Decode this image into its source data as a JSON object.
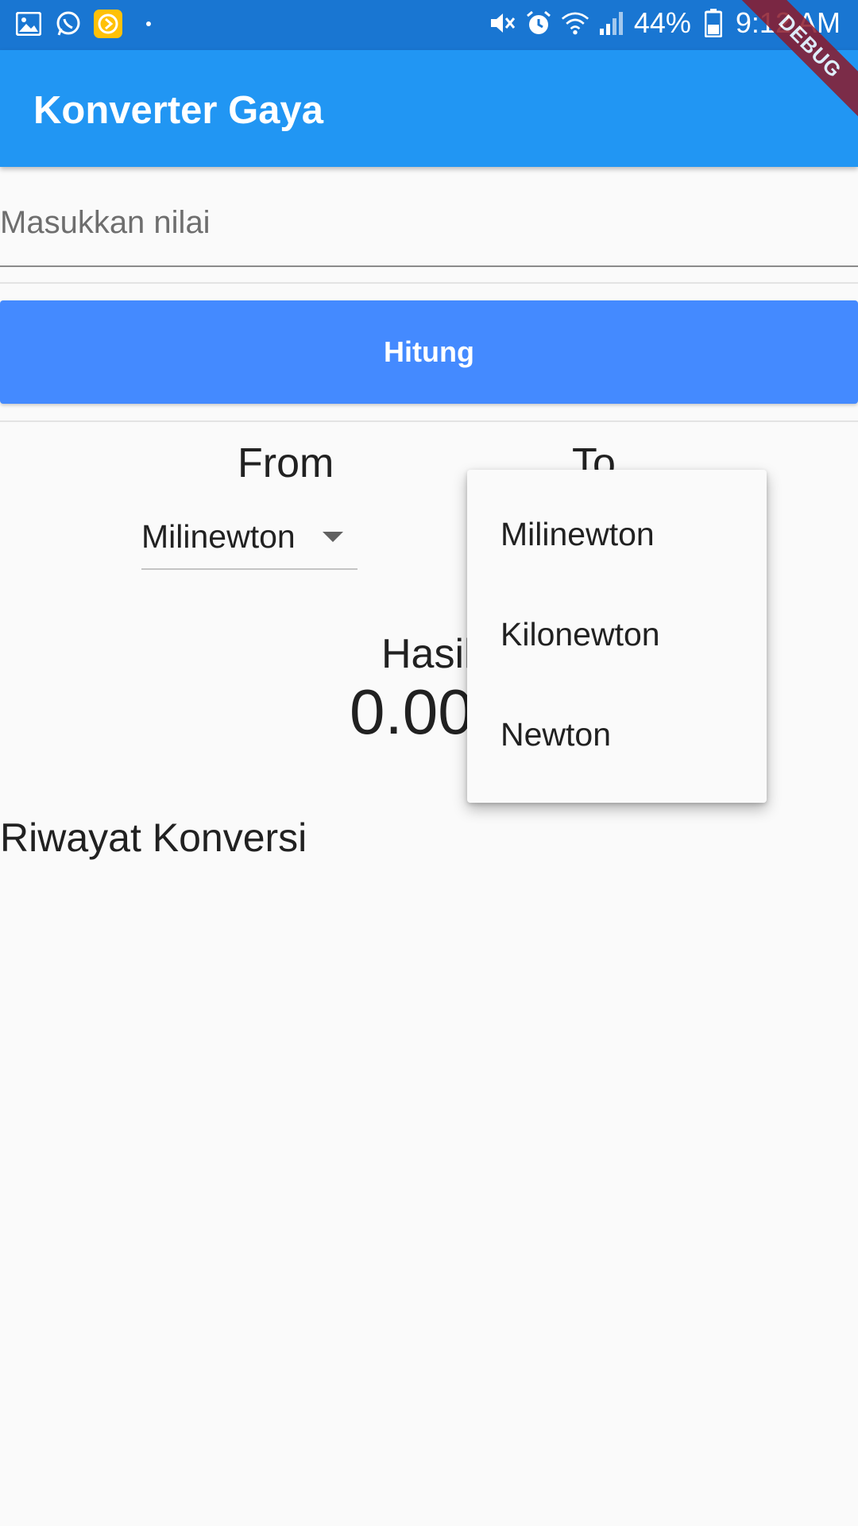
{
  "status_bar": {
    "battery": "44%",
    "time": "9:12 AM",
    "icons_left": [
      "gallery-icon",
      "whatsapp-icon",
      "app-notification-icon"
    ],
    "icons_right": [
      "mute-icon",
      "alarm-icon",
      "wifi-icon",
      "signal-icon",
      "battery-icon"
    ]
  },
  "debug_banner": "DEBUG",
  "app_bar": {
    "title": "Konverter Gaya"
  },
  "input": {
    "placeholder": "Masukkan nilai",
    "value": ""
  },
  "calculate_button": {
    "label": "Hitung"
  },
  "from": {
    "label": "From",
    "selected": "Milinewton"
  },
  "to": {
    "label": "To"
  },
  "result": {
    "label": "Hasil",
    "value": "0.00"
  },
  "history": {
    "title": "Riwayat Konversi"
  },
  "dropdown_menu": {
    "items": [
      "Milinewton",
      "Kilonewton",
      "Newton"
    ]
  },
  "colors": {
    "status_bar": "#1976d2",
    "app_bar": "#2196f3",
    "button": "#448aff",
    "background": "#fafafa"
  }
}
